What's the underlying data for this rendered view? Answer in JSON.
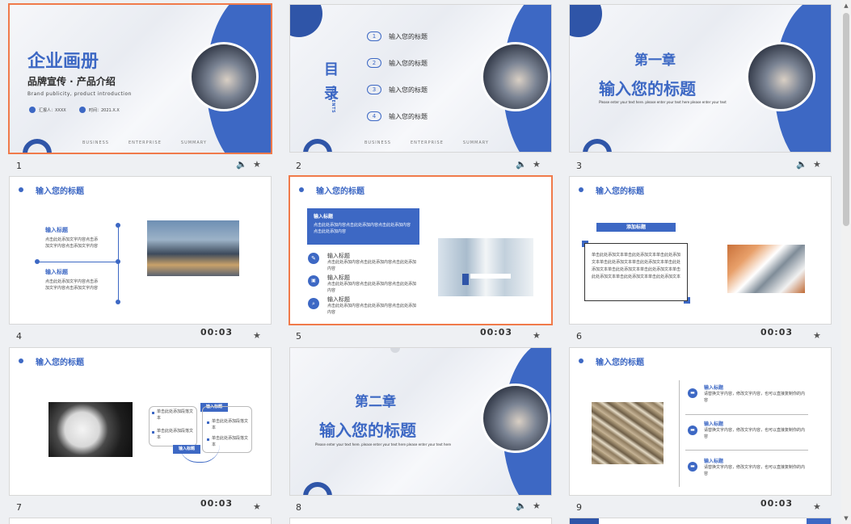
{
  "slides": [
    {
      "num": "1",
      "title": "企业画册",
      "subtitle": "品牌宣传 · 产品介绍",
      "english": "Brand publicity, product introduction",
      "reporter": "汇报人：XXXX",
      "date": "时间：2021.X.X",
      "footer": [
        "BUSINESS",
        "ENTERPRISE",
        "SUMMARY"
      ]
    },
    {
      "num": "2",
      "mulu_1": "目",
      "mulu_2": "录",
      "contents": "CONTENTS",
      "items": [
        {
          "n": "1",
          "label": "输入您的标题"
        },
        {
          "n": "2",
          "label": "输入您的标题"
        },
        {
          "n": "3",
          "label": "输入您的标题"
        },
        {
          "n": "4",
          "label": "输入您的标题"
        }
      ],
      "footer": [
        "BUSINESS",
        "ENTERPRISE",
        "SUMMARY"
      ]
    },
    {
      "num": "3",
      "chapter": "第一章",
      "title": "输入您的标题",
      "desc": "Please enter your text here. please enter your text here please enter your text"
    },
    {
      "num": "4",
      "header": "输入您的标题",
      "time": "00:03",
      "block1_title": "输入标题",
      "block1_text": "点击此处添加文字内容点击添加文字内容点击添加文字内容",
      "block2_title": "输入标题",
      "block2_text": "点击此处添加文字内容点击添加文字内容点击添加文字内容"
    },
    {
      "num": "5",
      "header": "输入您的标题",
      "time": "00:03",
      "box_title": "输入标题",
      "box_text": "点击此处添加内容点击此处添加内容点击此处添加内容点击此处添加内容",
      "rows": [
        {
          "title": "输入标题",
          "text": "点击此处添加内容点击此处添加内容点击此处添加内容"
        },
        {
          "title": "输入标题",
          "text": "点击此处添加内容点击此处添加内容点击此处添加内容"
        },
        {
          "title": "输入标题",
          "text": "点击此处添加内容点击此处添加内容点击此处添加内容"
        }
      ]
    },
    {
      "num": "6",
      "header": "输入您的标题",
      "time": "00:03",
      "tag": "添加标题",
      "text": "单击此处添加文本单击此处添加文本单击此处添加文本单击此处添加文本单击此处添加文本单击此处添加文本单击此处添加文本单击此处添加文本单击此处添加文本单击此处添加文本单击此处添加文本"
    },
    {
      "num": "7",
      "header": "输入您的标题",
      "time": "00:03",
      "tag_top": "输入标题",
      "tag_bottom": "输入标题",
      "b1": "单击此处添加段落文本",
      "b2": "单击此处添加段落文本",
      "b3": "单击此处添加段落文本",
      "b4": "单击此处添加段落文本"
    },
    {
      "num": "8",
      "chapter": "第二章",
      "title": "输入您的标题",
      "desc": "Please enter your text here. please enter your text here please enter your text here"
    },
    {
      "num": "9",
      "header": "输入您的标题",
      "time": "00:03",
      "items": [
        {
          "title": "输入标题",
          "text": "请替换文字内容，修改文字内容，也可以直接复制你的内容"
        },
        {
          "title": "输入标题",
          "text": "请替换文字内容，修改文字内容，也可以直接复制你的内容"
        },
        {
          "title": "输入标题",
          "text": "请替换文字内容，修改文字内容，也可以直接复制你的内容"
        }
      ]
    }
  ],
  "icons": {
    "audio": "speaker-icon",
    "star": "star-icon"
  },
  "colors": {
    "primary": "#3d68c4",
    "selected_border": "#f07a4a"
  }
}
